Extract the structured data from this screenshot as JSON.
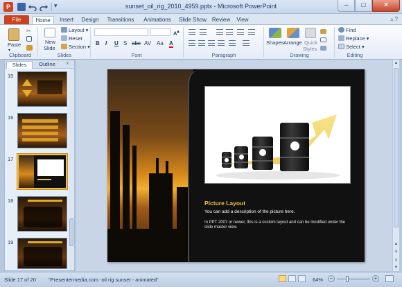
{
  "window": {
    "title": "sunset_oil_rig_2010_4959.pptx - Microsoft PowerPoint",
    "app_icon_letter": "P"
  },
  "tabs": {
    "file": "File",
    "items": [
      "Home",
      "Insert",
      "Design",
      "Transitions",
      "Animations",
      "Slide Show",
      "Review",
      "View"
    ],
    "active": "Home"
  },
  "ribbon": {
    "clipboard": {
      "label": "Clipboard",
      "paste": "Paste"
    },
    "slides": {
      "label": "Slides",
      "new_slide": "New",
      "new_slide_2": "Slide",
      "layout": "Layout",
      "reset": "Reset",
      "section": "Section"
    },
    "font": {
      "label": "Font",
      "bold": "B",
      "italic": "I",
      "underline": "U",
      "strike": "S",
      "shadow": "abc",
      "spacing": "AV",
      "case": "Aa",
      "color": "A"
    },
    "paragraph": {
      "label": "Paragraph"
    },
    "drawing": {
      "label": "Drawing",
      "shapes": "Shapes",
      "arrange": "Arrange",
      "quick_styles": "Quick",
      "quick_styles_2": "Styles"
    },
    "editing": {
      "label": "Editing",
      "find": "Find",
      "replace": "Replace",
      "select": "Select"
    }
  },
  "left_pane": {
    "tab_slides": "Slides",
    "tab_outline": "Outline",
    "close": "×",
    "thumbnails": [
      {
        "num": "15"
      },
      {
        "num": "16"
      },
      {
        "num": "17"
      },
      {
        "num": "18"
      },
      {
        "num": "19"
      }
    ],
    "selected": "17"
  },
  "slide": {
    "title": "Picture Layout",
    "description": "You can add a description of the picture here.",
    "note": "In PPT 2007 or newer, this is a custom layout and can be modified under the slide master view."
  },
  "status": {
    "slide_info": "Slide 17 of 20",
    "theme": "\"Presentermedia.com -oil rig sunset - animated\"",
    "zoom": "64%",
    "zoom_level_pct": 64
  },
  "colors": {
    "file_tab": "#c8431e",
    "selected_thumb_border": "#f1c04b",
    "slide_title": "#f0c04a",
    "arrow_gold": "#f2d35a"
  }
}
